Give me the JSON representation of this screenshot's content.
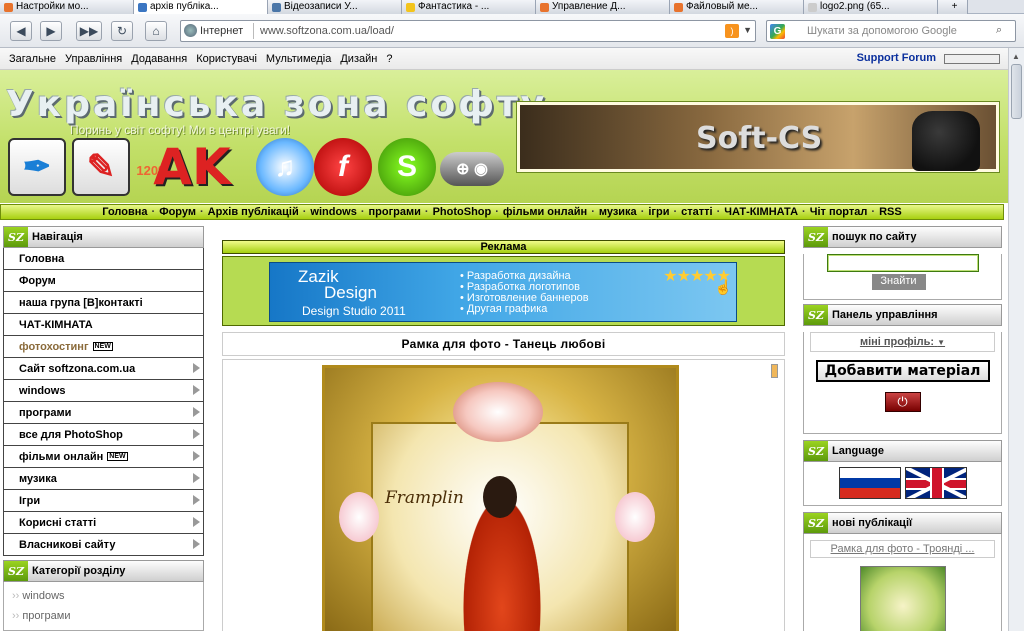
{
  "browser": {
    "tabs": [
      {
        "label": "Настройки мо...",
        "color": "#e8732d"
      },
      {
        "label": "архів публіка...",
        "color": "#3b76c2",
        "active": true
      },
      {
        "label": "Відеозаписи У...",
        "color": "#4a76a8"
      },
      {
        "label": "Фантастика - ...",
        "color": "#f3c41d"
      },
      {
        "label": "Управление Д...",
        "color": "#e8732d"
      },
      {
        "label": "Файловый ме...",
        "color": "#e8732d"
      },
      {
        "label": "logo2.png (65...",
        "color": "#cccccc"
      }
    ],
    "zone_label": "Інтернет",
    "url": "www.softzona.com.ua/load/",
    "search_placeholder": "Шукати за допомогою Google",
    "search_engine": "G",
    "rss_label": "RSS"
  },
  "menubar": {
    "items": [
      "Загальне",
      "Управління",
      "Додавання",
      "Користувачі",
      "Мультимедіа",
      "Дизайн",
      "?"
    ],
    "support": "Support Forum"
  },
  "header": {
    "title": "Українська зона софту",
    "tagline": "Поринь у світ софту! Ми в центрі уваги!",
    "banner_text": "Soft-CS",
    "logo_icons": [
      "feather-icon",
      "pdf-icon",
      "ak-icon",
      "itunes-icon",
      "flash-icon",
      "skype-icon",
      "gamepad-icon"
    ],
    "logo_percent": "120%"
  },
  "topnav": [
    "Головна",
    "Форум",
    "Архів публікацій",
    "windows",
    "програми",
    "PhotoShop",
    "фільми онлайн",
    "музика",
    "ігри",
    "статті",
    "ЧАТ-КІМНАТА",
    "Чіт портал",
    "RSS"
  ],
  "left": {
    "nav_title": "Навігація",
    "nav_items": [
      {
        "label": "Головна",
        "arrow": false,
        "new": false
      },
      {
        "label": "Форум",
        "arrow": false,
        "new": false
      },
      {
        "label": "наша група [В]контакті",
        "arrow": false,
        "new": false
      },
      {
        "label": "ЧАТ-КІМНАТА",
        "arrow": false,
        "new": false
      },
      {
        "label": "фотохостинг",
        "arrow": false,
        "new": true,
        "muted": true
      },
      {
        "label": "Сайт softzona.com.ua",
        "arrow": true,
        "new": false
      },
      {
        "label": "windows",
        "arrow": true,
        "new": false
      },
      {
        "label": "програми",
        "arrow": true,
        "new": false
      },
      {
        "label": "все для PhotoShop",
        "arrow": true,
        "new": false
      },
      {
        "label": "фільми онлайн",
        "arrow": true,
        "new": true
      },
      {
        "label": "музика",
        "arrow": true,
        "new": false
      },
      {
        "label": "Ігри",
        "arrow": true,
        "new": false
      },
      {
        "label": "Корисні статті",
        "arrow": true,
        "new": false
      },
      {
        "label": "Власникові сайту",
        "arrow": true,
        "new": false
      }
    ],
    "new_badge": "NEW",
    "cat_title": "Категорії розділу",
    "cat_items": [
      "windows",
      "програми"
    ]
  },
  "center": {
    "ad_title": "Реклама",
    "ad": {
      "brand1": "Zazik",
      "brand2": "Design",
      "brand3": "Design Studio 2011",
      "bullets": [
        "Разработка дизайна",
        "Разработка логотипов",
        "Изготовление баннеров",
        "Другая графика"
      ],
      "stars": "★★★★★"
    },
    "post_title": "Рамка для фото - Танець любові",
    "photo_signature": "Framplin"
  },
  "right": {
    "search_title": "пошук по сайту",
    "search_button": "Знайти",
    "panel_title": "Панель управління",
    "profile_label": "міні профіль:",
    "add_button": "Добавити матеріал",
    "power_icon": "⏻",
    "lang_title": "Language",
    "new_title": "нові публікації",
    "new_link": "Рамка для фото - Трояндi ..."
  },
  "sz_badge": "SZ"
}
